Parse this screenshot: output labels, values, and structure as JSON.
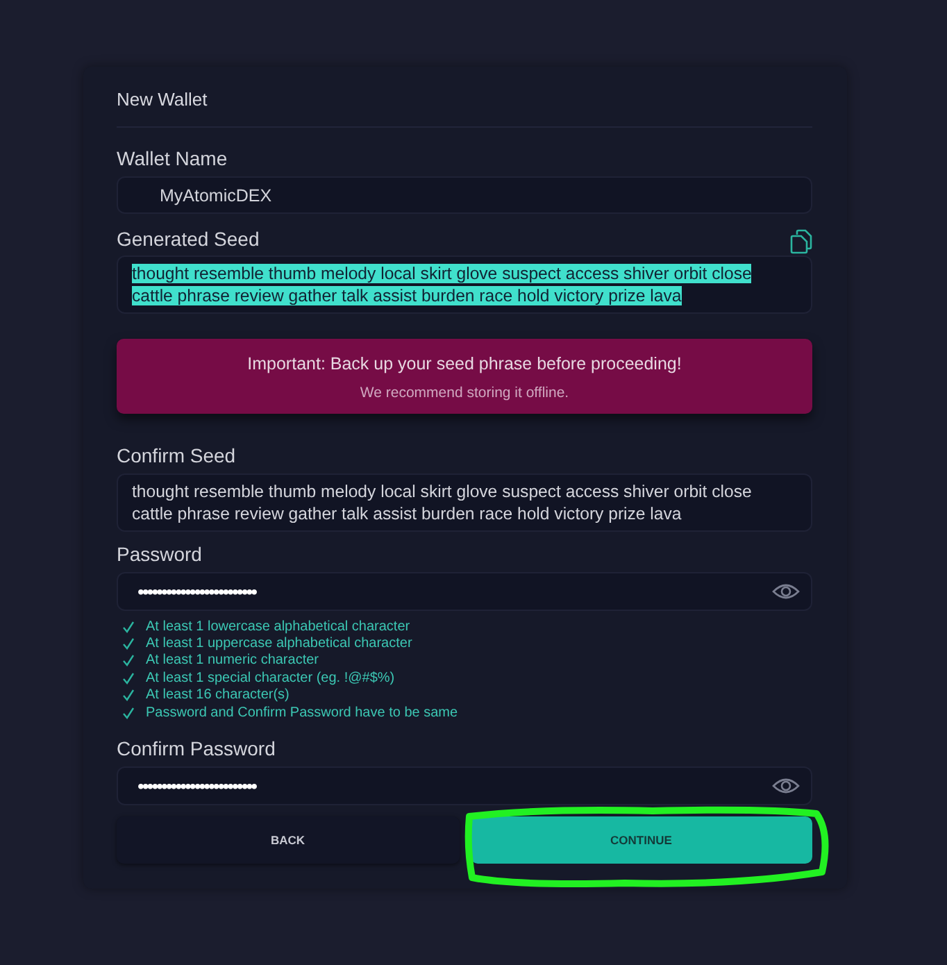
{
  "title": "New Wallet",
  "wallet_name": {
    "label": "Wallet Name",
    "value": "MyAtomicDEX"
  },
  "generated_seed": {
    "label": "Generated Seed",
    "value": "thought resemble thumb melody local skirt glove suspect access shiver orbit close cattle phrase review gather talk assist burden race hold victory prize lava",
    "selected": true
  },
  "alert": {
    "title": "Important: Back up your seed phrase before proceeding!",
    "message": "We recommend storing it offline."
  },
  "confirm_seed": {
    "label": "Confirm Seed",
    "value": "thought resemble thumb melody local skirt glove suspect access shiver orbit close cattle phrase review gather talk assist burden race hold victory prize lava"
  },
  "password": {
    "label": "Password",
    "value": "•••••••••••••••••••••••••"
  },
  "requirements": [
    {
      "text": "At least 1 lowercase alphabetical character",
      "met": true
    },
    {
      "text": "At least 1 uppercase alphabetical character",
      "met": true
    },
    {
      "text": "At least 1 numeric character",
      "met": true
    },
    {
      "text": "At least 1 special character (eg. !@#$%)",
      "met": true
    },
    {
      "text": "At least 16 character(s)",
      "met": true
    },
    {
      "text": "Password and Confirm Password have to be same",
      "met": true
    }
  ],
  "confirm_password": {
    "label": "Confirm Password",
    "value": "•••••••••••••••••••••••••"
  },
  "buttons": [
    {
      "label": "BACK",
      "kind": "secondary"
    },
    {
      "label": "CONTINUE",
      "kind": "primary"
    }
  ]
}
